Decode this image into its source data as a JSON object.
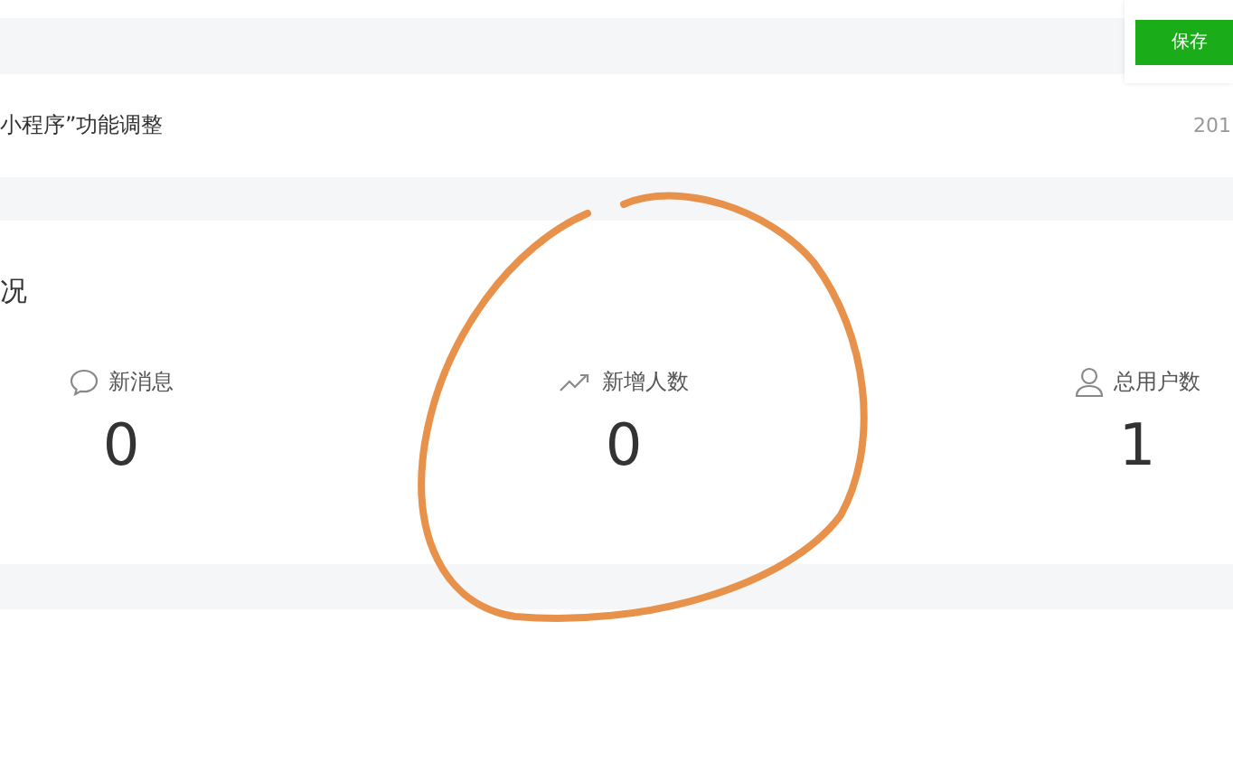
{
  "save_button": {
    "label": "保存"
  },
  "notice": {
    "title": "小程序”功能调整",
    "date": "201"
  },
  "overview": {
    "title": "况",
    "stats": [
      {
        "kind": "message",
        "label": "新消息",
        "value": "0"
      },
      {
        "kind": "trend",
        "label": "新增人数",
        "value": "0"
      },
      {
        "kind": "user",
        "label": "总用户数",
        "value": "1"
      }
    ]
  }
}
